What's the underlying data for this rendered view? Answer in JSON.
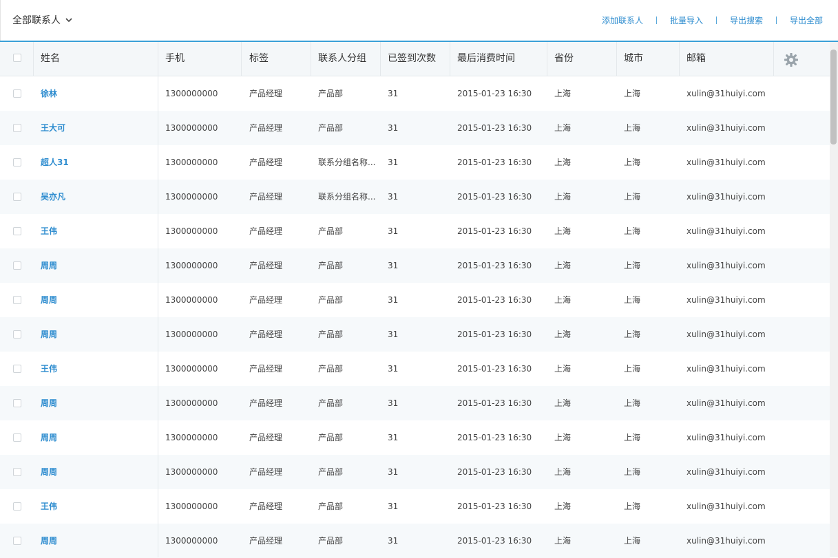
{
  "toolbar": {
    "filter_label": "全部联系人",
    "actions": [
      "添加联系人",
      "批量导入",
      "导出搜索",
      "导出全部"
    ]
  },
  "columns": [
    "姓名",
    "手机",
    "标签",
    "联系人分组",
    "已签到次数",
    "最后消费时间",
    "省份",
    "城市",
    "邮箱"
  ],
  "rows": [
    {
      "name": "徐林",
      "phone": "1300000000",
      "tag": "产品经理",
      "group": "产品部",
      "checkins": "31",
      "last_time": "2015-01-23 16:30",
      "province": "上海",
      "city": "上海",
      "email": "xulin@31huiyi.com"
    },
    {
      "name": "王大可",
      "phone": "1300000000",
      "tag": "产品经理",
      "group": "产品部",
      "checkins": "31",
      "last_time": "2015-01-23 16:30",
      "province": "上海",
      "city": "上海",
      "email": "xulin@31huiyi.com"
    },
    {
      "name": "超人31",
      "phone": "1300000000",
      "tag": "产品经理",
      "group": "联系分组名称...",
      "checkins": "31",
      "last_time": "2015-01-23 16:30",
      "province": "上海",
      "city": "上海",
      "email": "xulin@31huiyi.com"
    },
    {
      "name": "吴亦凡",
      "phone": "1300000000",
      "tag": "产品经理",
      "group": "联系分组名称...",
      "checkins": "31",
      "last_time": "2015-01-23 16:30",
      "province": "上海",
      "city": "上海",
      "email": "xulin@31huiyi.com"
    },
    {
      "name": "王伟",
      "phone": "1300000000",
      "tag": "产品经理",
      "group": "产品部",
      "checkins": "31",
      "last_time": "2015-01-23 16:30",
      "province": "上海",
      "city": "上海",
      "email": "xulin@31huiyi.com"
    },
    {
      "name": "周周",
      "phone": "1300000000",
      "tag": "产品经理",
      "group": "产品部",
      "checkins": "31",
      "last_time": "2015-01-23 16:30",
      "province": "上海",
      "city": "上海",
      "email": "xulin@31huiyi.com"
    },
    {
      "name": "周周",
      "phone": "1300000000",
      "tag": "产品经理",
      "group": "产品部",
      "checkins": "31",
      "last_time": "2015-01-23 16:30",
      "province": "上海",
      "city": "上海",
      "email": "xulin@31huiyi.com"
    },
    {
      "name": "周周",
      "phone": "1300000000",
      "tag": "产品经理",
      "group": "产品部",
      "checkins": "31",
      "last_time": "2015-01-23 16:30",
      "province": "上海",
      "city": "上海",
      "email": "xulin@31huiyi.com"
    },
    {
      "name": "王伟",
      "phone": "1300000000",
      "tag": "产品经理",
      "group": "产品部",
      "checkins": "31",
      "last_time": "2015-01-23 16:30",
      "province": "上海",
      "city": "上海",
      "email": "xulin@31huiyi.com"
    },
    {
      "name": "周周",
      "phone": "1300000000",
      "tag": "产品经理",
      "group": "产品部",
      "checkins": "31",
      "last_time": "2015-01-23 16:30",
      "province": "上海",
      "city": "上海",
      "email": "xulin@31huiyi.com"
    },
    {
      "name": "周周",
      "phone": "1300000000",
      "tag": "产品经理",
      "group": "产品部",
      "checkins": "31",
      "last_time": "2015-01-23 16:30",
      "province": "上海",
      "city": "上海",
      "email": "xulin@31huiyi.com"
    },
    {
      "name": "周周",
      "phone": "1300000000",
      "tag": "产品经理",
      "group": "产品部",
      "checkins": "31",
      "last_time": "2015-01-23 16:30",
      "province": "上海",
      "city": "上海",
      "email": "xulin@31huiyi.com"
    },
    {
      "name": "王伟",
      "phone": "1300000000",
      "tag": "产品经理",
      "group": "产品部",
      "checkins": "31",
      "last_time": "2015-01-23 16:30",
      "province": "上海",
      "city": "上海",
      "email": "xulin@31huiyi.com"
    },
    {
      "name": "周周",
      "phone": "1300000000",
      "tag": "产品经理",
      "group": "产品部",
      "checkins": "31",
      "last_time": "2015-01-23 16:30",
      "province": "上海",
      "city": "上海",
      "email": "xulin@31huiyi.com"
    }
  ],
  "colors": {
    "accent": "#2d8ccf",
    "header_bg": "#f4f7f9",
    "alt_row_bg": "#f6f9fb",
    "top_border": "#3aa0d8"
  },
  "icons": {
    "dropdown": "chevron-down-icon",
    "settings": "gear-icon"
  }
}
